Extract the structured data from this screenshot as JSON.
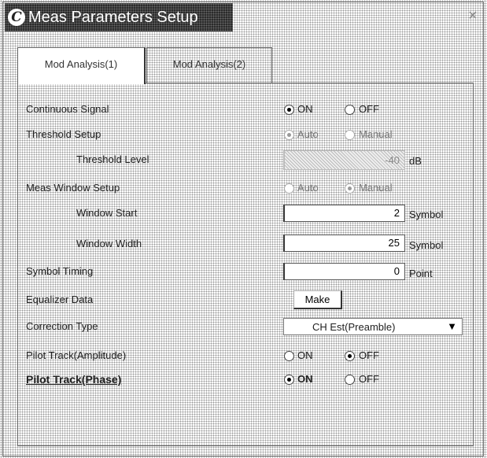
{
  "window": {
    "title": "Meas Parameters Setup",
    "close_label": "×",
    "icon_glyph": "C"
  },
  "tabs": [
    {
      "label": "Mod Analysis(1)",
      "selected": true
    },
    {
      "label": "Mod Analysis(2)",
      "selected": false
    }
  ],
  "params": {
    "continuous_signal": {
      "label": "Continuous Signal",
      "on_label": "ON",
      "off_label": "OFF",
      "value": "ON"
    },
    "threshold_setup": {
      "label": "Threshold Setup",
      "auto_label": "Auto",
      "manual_label": "Manual",
      "value": "Auto",
      "enabled": false
    },
    "threshold_level": {
      "label": "Threshold Level",
      "value": "-40",
      "unit": "dB",
      "enabled": false
    },
    "meas_window_setup": {
      "label": "Meas Window Setup",
      "auto_label": "Auto",
      "manual_label": "Manual",
      "value": "Manual",
      "enabled": false
    },
    "window_start": {
      "label": "Window Start",
      "value": "2",
      "unit": "Symbol"
    },
    "window_width": {
      "label": "Window Width",
      "value": "25",
      "unit": "Symbol"
    },
    "symbol_timing": {
      "label": "Symbol Timing",
      "value": "0",
      "unit": "Point"
    },
    "equalizer_data": {
      "label": "Equalizer Data",
      "button_label": "Make"
    },
    "correction_type": {
      "label": "Correction Type",
      "value": "CH Est(Preamble)"
    },
    "pilot_track_amplitude": {
      "label": "Pilot Track(Amplitude)",
      "on_label": "ON",
      "off_label": "OFF",
      "value": "OFF"
    },
    "pilot_track_phase": {
      "label": "Pilot Track(Phase)",
      "on_label": "ON",
      "off_label": "OFF",
      "value": "ON"
    }
  }
}
